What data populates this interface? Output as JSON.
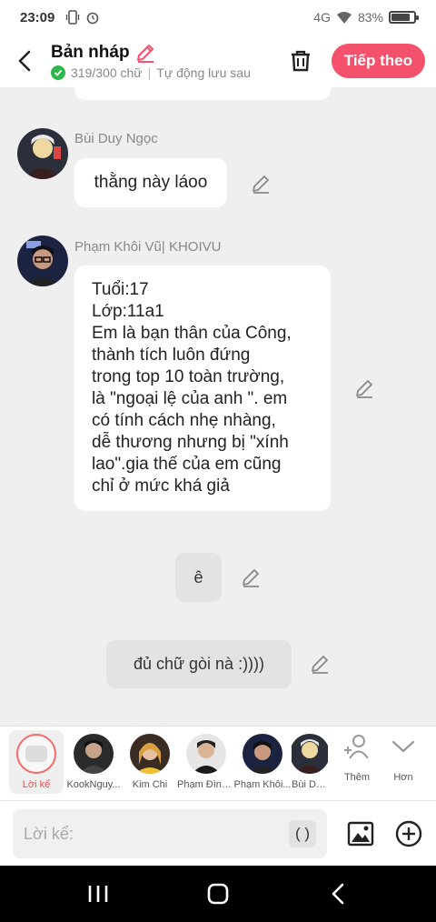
{
  "status": {
    "time": "23:09",
    "network": "4G",
    "battery_percent": "83%",
    "battery_level": 0.83
  },
  "header": {
    "title": "Bản nháp",
    "word_count": "319/300 chữ",
    "autosave": "Tự động lưu sau",
    "next_label": "Tiếp theo"
  },
  "messages": [
    {
      "author": "Bùi Duy Ngọc",
      "text": "thằng này láoo"
    },
    {
      "author": "Phạm Khôi Vũ| KHOIVU",
      "lines": [
        "Tuổi:17",
        "Lớp:11a1",
        "Em là bạn thân của Công,",
        "thành tích luôn đứng",
        "trong top 10 toàn trường,",
        "là \"ngoại lệ của anh \". em",
        "có tính cách nhẹ nhàng,",
        "dễ thương nhưng bị \"xính",
        "lao\".gia thế của em cũng",
        "chỉ ở mức khá giả"
      ]
    },
    {
      "text": "ê"
    },
    {
      "text": "đủ chữ gòi nà :))))"
    }
  ],
  "characters": [
    {
      "name": "Lời kể"
    },
    {
      "name": "KookNguy..."
    },
    {
      "name": "Kim Chi"
    },
    {
      "name": "Phạm Đình..."
    },
    {
      "name": "Phạm Khôi..."
    },
    {
      "name": "Bùi Du..."
    }
  ],
  "strip_actions": {
    "more_label": "Thêm",
    "less_label": "Hơn"
  },
  "input": {
    "placeholder": "Lời kể:",
    "paren": "( )"
  },
  "colors": {
    "accent": "#f4516c",
    "check": "#2db84b"
  }
}
